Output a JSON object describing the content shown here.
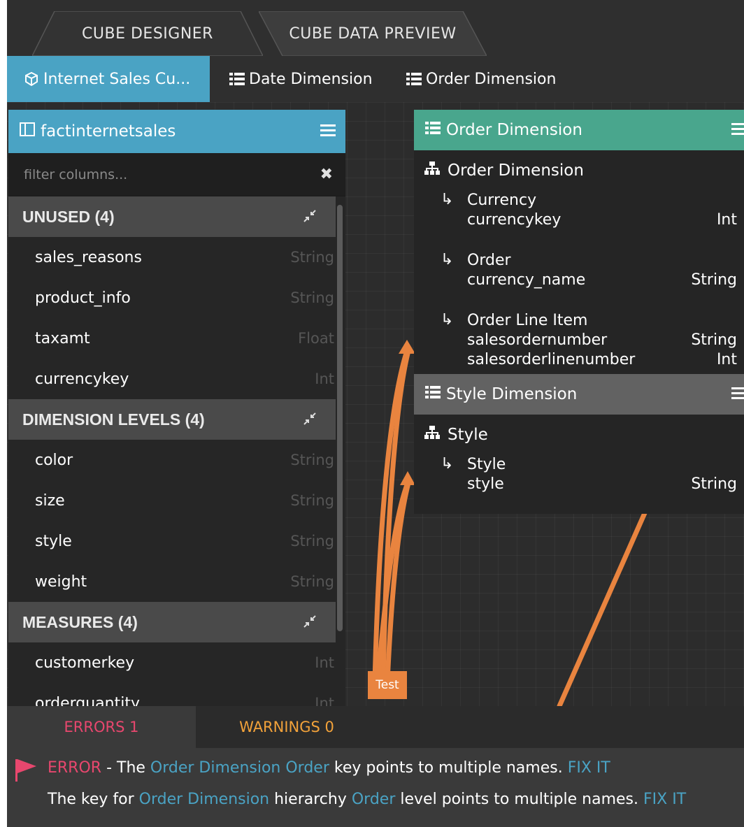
{
  "top_tabs": {
    "designer": "CUBE DESIGNER",
    "preview": "CUBE DATA PREVIEW"
  },
  "cube_tabs": [
    {
      "label": "Internet Sales Cu...",
      "icon": "cube-icon",
      "active": true
    },
    {
      "label": "Date Dimension",
      "icon": "list-icon",
      "active": false
    },
    {
      "label": "Order Dimension",
      "icon": "list-icon",
      "active": false
    }
  ],
  "fact_table": {
    "title": "factinternetsales",
    "filter_placeholder": "filter columns...",
    "sections": {
      "unused": {
        "label": "UNUSED (4)",
        "rows": [
          {
            "name": "sales_reasons",
            "type": "String"
          },
          {
            "name": "product_info",
            "type": "String"
          },
          {
            "name": "taxamt",
            "type": "Float"
          },
          {
            "name": "currencykey",
            "type": "Int"
          }
        ]
      },
      "dimension_levels": {
        "label": "DIMENSION LEVELS (4)",
        "rows": [
          {
            "name": "color",
            "type": "String"
          },
          {
            "name": "size",
            "type": "String"
          },
          {
            "name": "style",
            "type": "String"
          },
          {
            "name": "weight",
            "type": "String"
          }
        ]
      },
      "measures": {
        "label": "MEASURES (4)",
        "rows": [
          {
            "name": "customerkey",
            "type": "Int"
          },
          {
            "name": "orderquantity",
            "type": "Int"
          }
        ]
      }
    }
  },
  "order_dimension": {
    "title": "Order Dimension",
    "hierarchy": "Order Dimension",
    "levels": [
      {
        "name": "Currency",
        "attrs": [
          {
            "name": "currencykey",
            "type": "Int"
          }
        ]
      },
      {
        "name": "Order",
        "attrs": [
          {
            "name": "currency_name",
            "type": "String"
          }
        ]
      },
      {
        "name": "Order Line Item",
        "attrs": [
          {
            "name": "salesordernumber",
            "type": "String"
          },
          {
            "name": "salesorderlinenumber",
            "type": "Int"
          }
        ]
      }
    ],
    "header_color": "#49a68d"
  },
  "style_dimension": {
    "title": "Style Dimension",
    "hierarchy": "Style",
    "levels": [
      {
        "name": "Style",
        "attrs": [
          {
            "name": "style",
            "type": "String"
          }
        ]
      }
    ],
    "header_color": "#626262"
  },
  "link_label": "Test",
  "bottom": {
    "errors_tab": "ERRORS 1",
    "warnings_tab": "WARNINGS 0",
    "message1": {
      "prefix": "ERROR",
      "t1": " - The ",
      "l1": "Order Dimension Order",
      "t2": " key points to multiple names. ",
      "fix": "FIX IT"
    },
    "message2": {
      "t1": "The key for ",
      "l1": "Order Dimension",
      "t2": " hierarchy ",
      "l2": "Order",
      "t3": " level points to multiple names. ",
      "fix": "FIX IT"
    }
  },
  "colors": {
    "accent_blue": "#4aa3c4",
    "link_orange": "#e9843f",
    "error_red": "#e8476e",
    "warning_orange": "#f2a23a"
  }
}
